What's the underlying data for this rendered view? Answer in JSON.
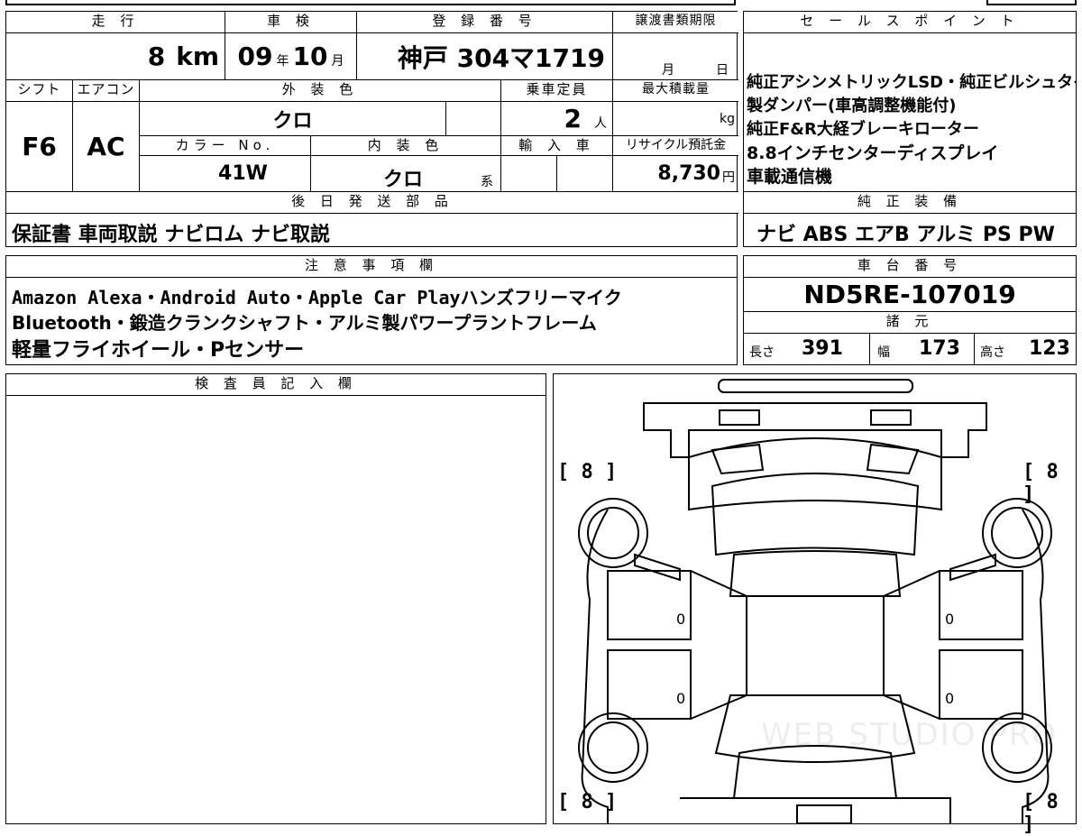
{
  "sheet": {
    "mileage": {
      "label": "走 行",
      "value": "8",
      "unit": "km"
    },
    "inspection": {
      "label": "車 検",
      "year": "09",
      "year_unit": "年",
      "month": "10",
      "month_unit": "月"
    },
    "registration": {
      "label": "登 録 番 号",
      "value": "神戸 304マ1719"
    },
    "transfer_deadline": {
      "label": "譲渡書類期限",
      "month_unit": "月",
      "day_unit": "日"
    },
    "shift": {
      "label": "シフト",
      "value": "F6"
    },
    "aircon": {
      "label": "エアコン",
      "value": "AC"
    },
    "exterior_color": {
      "label": "外 装 色",
      "value": "クロ"
    },
    "capacity": {
      "label": "乗車定員",
      "value": "2",
      "unit": "人"
    },
    "max_load": {
      "label": "最大積載量",
      "unit": "kg"
    },
    "color_no": {
      "label": "カラー No.",
      "value": "41W"
    },
    "interior_color": {
      "label": "内 装 色",
      "value": "クロ",
      "suffix": "系"
    },
    "import": {
      "label": "輸 入 車"
    },
    "recycle_fee": {
      "label": "リサイクル預託金",
      "value": "8,730",
      "unit": "円"
    },
    "later_items": {
      "label": "後 日 発 送 部 品",
      "value": "保証書 車両取説 ナビロム ナビ取説"
    },
    "notes": {
      "label": "注 意 事 項 欄",
      "lines": [
        "Amazon Alexa・Android Auto・Apple Car Playハンズフリーマイク",
        "Bluetooth・鍛造クランクシャフト・アルミ製パワープラントフレーム",
        "軽量フライホイール・Pセンサー"
      ]
    },
    "inspector": {
      "label": "検 査 員 記 入 欄"
    }
  },
  "sales": {
    "label": "セ ー ル ス ポ イ ン ト",
    "lines": [
      "純正アシンメトリックLSD・純正ビルシュタイン",
      "製ダンパー(車高調整機能付)",
      "純正F&R大経ブレーキローター",
      "8.8インチセンターディスプレイ",
      "車載通信機"
    ]
  },
  "equipment": {
    "label": "純 正 装 備",
    "value": "ナビ ABS エアB アルミ PS PW"
  },
  "chassis": {
    "label": "車 台 番 号",
    "value": "ND5RE-107019"
  },
  "specs": {
    "label": "諸 元",
    "length": {
      "label": "長さ",
      "value": "391"
    },
    "width": {
      "label": "幅",
      "value": "173"
    },
    "height": {
      "label": "高さ",
      "value": "123"
    }
  },
  "diagram": {
    "tread_fl": "[ 8 ]",
    "tread_fr": "[ 8 ]",
    "tread_rl": "[ 8 ]",
    "tread_rr": "[ 8 ]",
    "door_fl": "0",
    "door_fr": "0",
    "door_rl": "0",
    "door_rr": "0",
    "watermark": "WEB STUDIO PRO"
  }
}
